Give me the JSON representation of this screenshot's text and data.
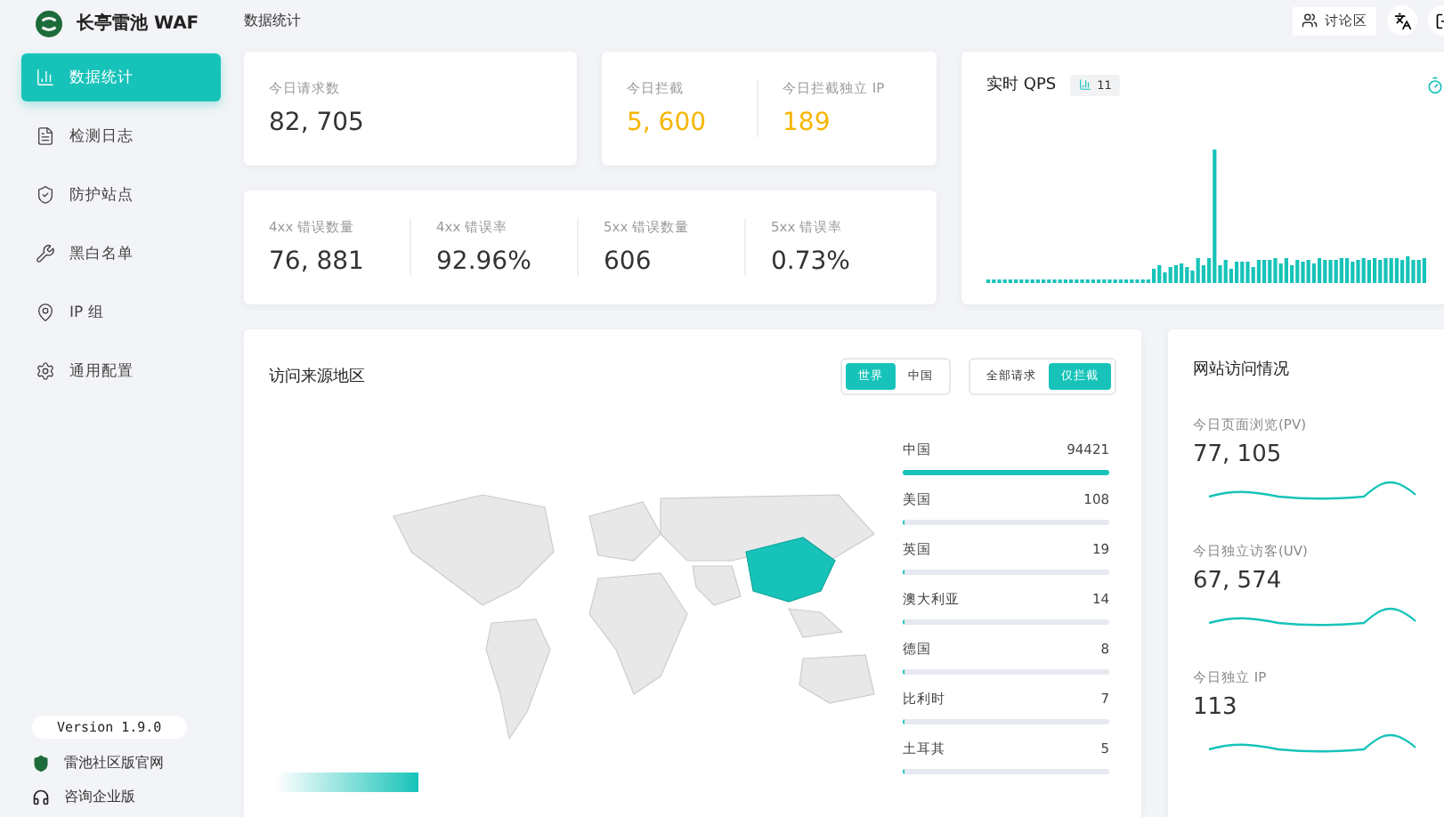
{
  "sidebar": {
    "brand": "长亭雷池 WAF",
    "items": [
      {
        "label": "数据统计",
        "selected": true
      },
      {
        "label": "检测日志",
        "selected": false
      },
      {
        "label": "防护站点",
        "selected": false
      },
      {
        "label": "黑白名单",
        "selected": false
      },
      {
        "label": "IP 组",
        "selected": false
      },
      {
        "label": "通用配置",
        "selected": false
      }
    ],
    "version": "Version 1.9.0",
    "links": [
      {
        "label": "雷池社区版官网"
      },
      {
        "label": "咨询企业版"
      }
    ]
  },
  "header": {
    "title": "数据统计",
    "forum_button": "讨论区"
  },
  "requests_card": {
    "label": "今日请求数",
    "value": "82, 705"
  },
  "blocked_card": [
    {
      "label": "今日拦截",
      "value": "5, 600"
    },
    {
      "label": "今日拦截独立 IP",
      "value": "189"
    }
  ],
  "errors_card": [
    {
      "label": "4xx 错误数量",
      "value": "76, 881"
    },
    {
      "label": "4xx 错误率",
      "value": "92.96%"
    },
    {
      "label": "5xx 错误数量",
      "value": "606"
    },
    {
      "label": "5xx 错误率",
      "value": "0.73%"
    }
  ],
  "qps": {
    "title": "实时 QPS",
    "current": "11"
  },
  "regions": {
    "title": "访问来源地区",
    "scope_toggle": [
      {
        "label": "世界",
        "selected": true
      },
      {
        "label": "中国",
        "selected": false
      }
    ],
    "filter_toggle": [
      {
        "label": "全部请求",
        "selected": false
      },
      {
        "label": "仅拦截",
        "selected": true
      }
    ],
    "countries": [
      {
        "name": "中国",
        "count": "94421",
        "level": 1
      },
      {
        "name": "美国",
        "count": "108",
        "level": 0.01
      },
      {
        "name": "英国",
        "count": "19",
        "level": 0.006
      },
      {
        "name": "澳大利亚",
        "count": "14",
        "level": 0.004
      },
      {
        "name": "德国",
        "count": "8",
        "level": 0.003
      },
      {
        "name": "比利时",
        "count": "7",
        "level": 0.002
      },
      {
        "name": "土耳其",
        "count": "5",
        "level": 0.001
      }
    ]
  },
  "site_visits": {
    "title": "网站访问情况",
    "metrics": [
      {
        "label": "今日页面浏览(PV)",
        "value": "77, 105"
      },
      {
        "label": "今日独立访客(UV)",
        "value": "67, 574"
      },
      {
        "label": "今日独立 IP",
        "value": "113"
      }
    ]
  }
}
